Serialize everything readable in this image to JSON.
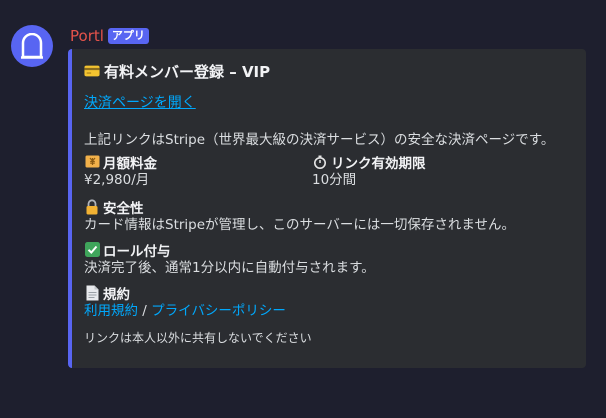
{
  "message": {
    "username": "Portl",
    "app_badge": "アプリ"
  },
  "embed": {
    "accent_color": "#5865f2",
    "title": "有料メンバー登録 – VIP",
    "title_icon": "credit-card-icon",
    "link_label": "決済ページを開く",
    "description": "上記リンクはStripe（世界最大級の決済サービス）の安全な決済ページです。",
    "fields": {
      "price": {
        "icon": "yen-banknote-icon",
        "name": "月額料金",
        "value": "¥2,980/月"
      },
      "expiry": {
        "icon": "stopwatch-icon",
        "name": "リンク有効期限",
        "value": "10分間"
      },
      "security": {
        "icon": "lock-icon",
        "name": "安全性",
        "value": "カード情報はStripeが管理し、このサーバーには一切保存されません。"
      },
      "role": {
        "icon": "check-mark-icon",
        "name": "ロール付与",
        "value": "決済完了後、通常1分以内に自動付与されます。"
      },
      "terms": {
        "icon": "page-icon",
        "name": "規約",
        "terms_link": "利用規約",
        "separator": " / ",
        "privacy_link": "プライバシーポリシー"
      }
    },
    "footer": "リンクは本人以外に共有しないでください"
  }
}
